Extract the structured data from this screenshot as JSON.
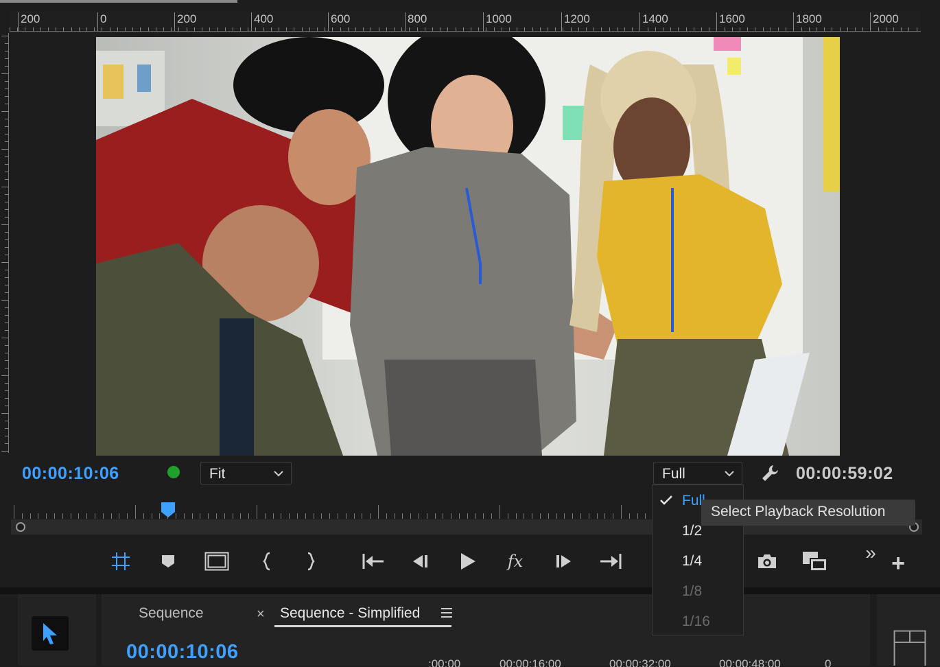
{
  "ruler": {
    "labels": [
      "200",
      "0",
      "200",
      "400",
      "600",
      "800",
      "1000",
      "1200",
      "1400",
      "1600",
      "1800",
      "2000"
    ]
  },
  "monitor": {
    "current_timecode": "00:00:10:06",
    "duration_timecode": "00:00:59:02",
    "zoom": {
      "value": "Fit"
    },
    "resolution": {
      "value": "Full"
    },
    "status_color": "#1fa12a",
    "accent_color": "#3ea0ff"
  },
  "resolution_menu": {
    "items": [
      {
        "label": "Full",
        "checked": true,
        "enabled": true
      },
      {
        "label": "1/2",
        "checked": false,
        "enabled": true
      },
      {
        "label": "1/4",
        "checked": false,
        "enabled": true
      },
      {
        "label": "1/8",
        "checked": false,
        "enabled": false
      },
      {
        "label": "1/16",
        "checked": false,
        "enabled": false
      }
    ],
    "tooltip": "Select Playback Resolution"
  },
  "transport": {
    "icons": [
      "safe-margins-icon",
      "add-marker-icon",
      "safe-frame-icon",
      "mark-in-icon",
      "mark-out-icon",
      "go-to-in-icon",
      "step-back-icon",
      "play-icon",
      "fx-icon",
      "step-forward-icon",
      "go-to-out-icon",
      "export-frame-icon",
      "compare-view-icon",
      "more-icon",
      "add-button-icon"
    ],
    "fx_label": "fx",
    "more_label": "»",
    "add_label": "+"
  },
  "timeline": {
    "tabs": [
      {
        "label": "Sequence",
        "active": false
      },
      {
        "label": "Sequence - Simplified",
        "active": true
      }
    ],
    "close_label": "×",
    "timecode": "00:00:10:06",
    "ruler_labels": [
      ":00:00",
      "00:00:16:00",
      "00:00:32:00",
      "00:00:48:00",
      "0"
    ]
  }
}
